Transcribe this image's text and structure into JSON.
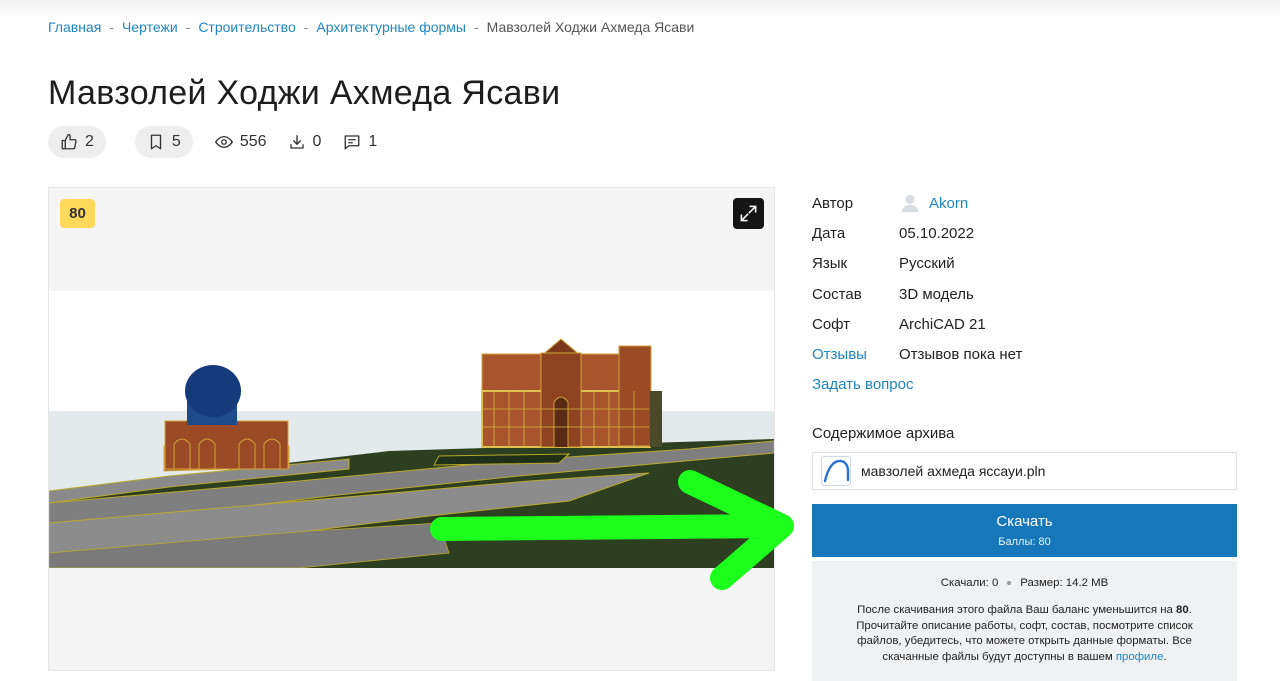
{
  "breadcrumb": {
    "items": [
      "Главная",
      "Чертежи",
      "Строительство",
      "Архитектурные формы"
    ],
    "separator": "-",
    "current": "Мавзолей Ходжи Ахмеда Ясави"
  },
  "page": {
    "title": "Мавзолей Ходжи Ахмеда Ясави"
  },
  "stats": {
    "likes": "2",
    "bookmarks": "5",
    "views": "556",
    "downloads": "0",
    "comments": "1"
  },
  "gallery": {
    "price_badge": "80"
  },
  "info": {
    "author_label": "Автор",
    "author_value": "Akorn",
    "date_label": "Дата",
    "date_value": "05.10.2022",
    "language_label": "Язык",
    "language_value": "Русский",
    "composition_label": "Состав",
    "composition_value": "3D модель",
    "software_label": "Софт",
    "software_value": "ArchiCAD 21",
    "reviews_label": "Отзывы",
    "reviews_value": "Отзывов пока нет",
    "ask_question": "Задать вопрос"
  },
  "archive": {
    "title": "Содержимое архива",
    "file_name": "мавзолей ахмеда яссауи.pln"
  },
  "download": {
    "button_label": "Скачать",
    "points": "Баллы: 80",
    "downloaded": "Скачали: 0",
    "size": "Размер: 14.2 MB",
    "note_part1": "После скачивания этого файла Ваш баланс уменьшится на",
    "note_amount": "80",
    "note_part2": ". Прочитайте описание работы, софт, состав, посмотрите список файлов, убедитесь, что можете открыть данные форматы. Все скачанные файлы будут доступны в вашем",
    "profile_link": "профиле",
    "note_end": "."
  },
  "colors": {
    "link": "#1f86bf",
    "download_button": "#1678b8",
    "price_badge": "#ffd95a",
    "overlay_arrow": "#1cff1c"
  },
  "icons": [
    "thumbs-up-icon",
    "bookmark-icon",
    "eye-icon",
    "download-icon",
    "comment-icon",
    "expand-icon",
    "avatar-icon",
    "archicad-file-icon"
  ]
}
